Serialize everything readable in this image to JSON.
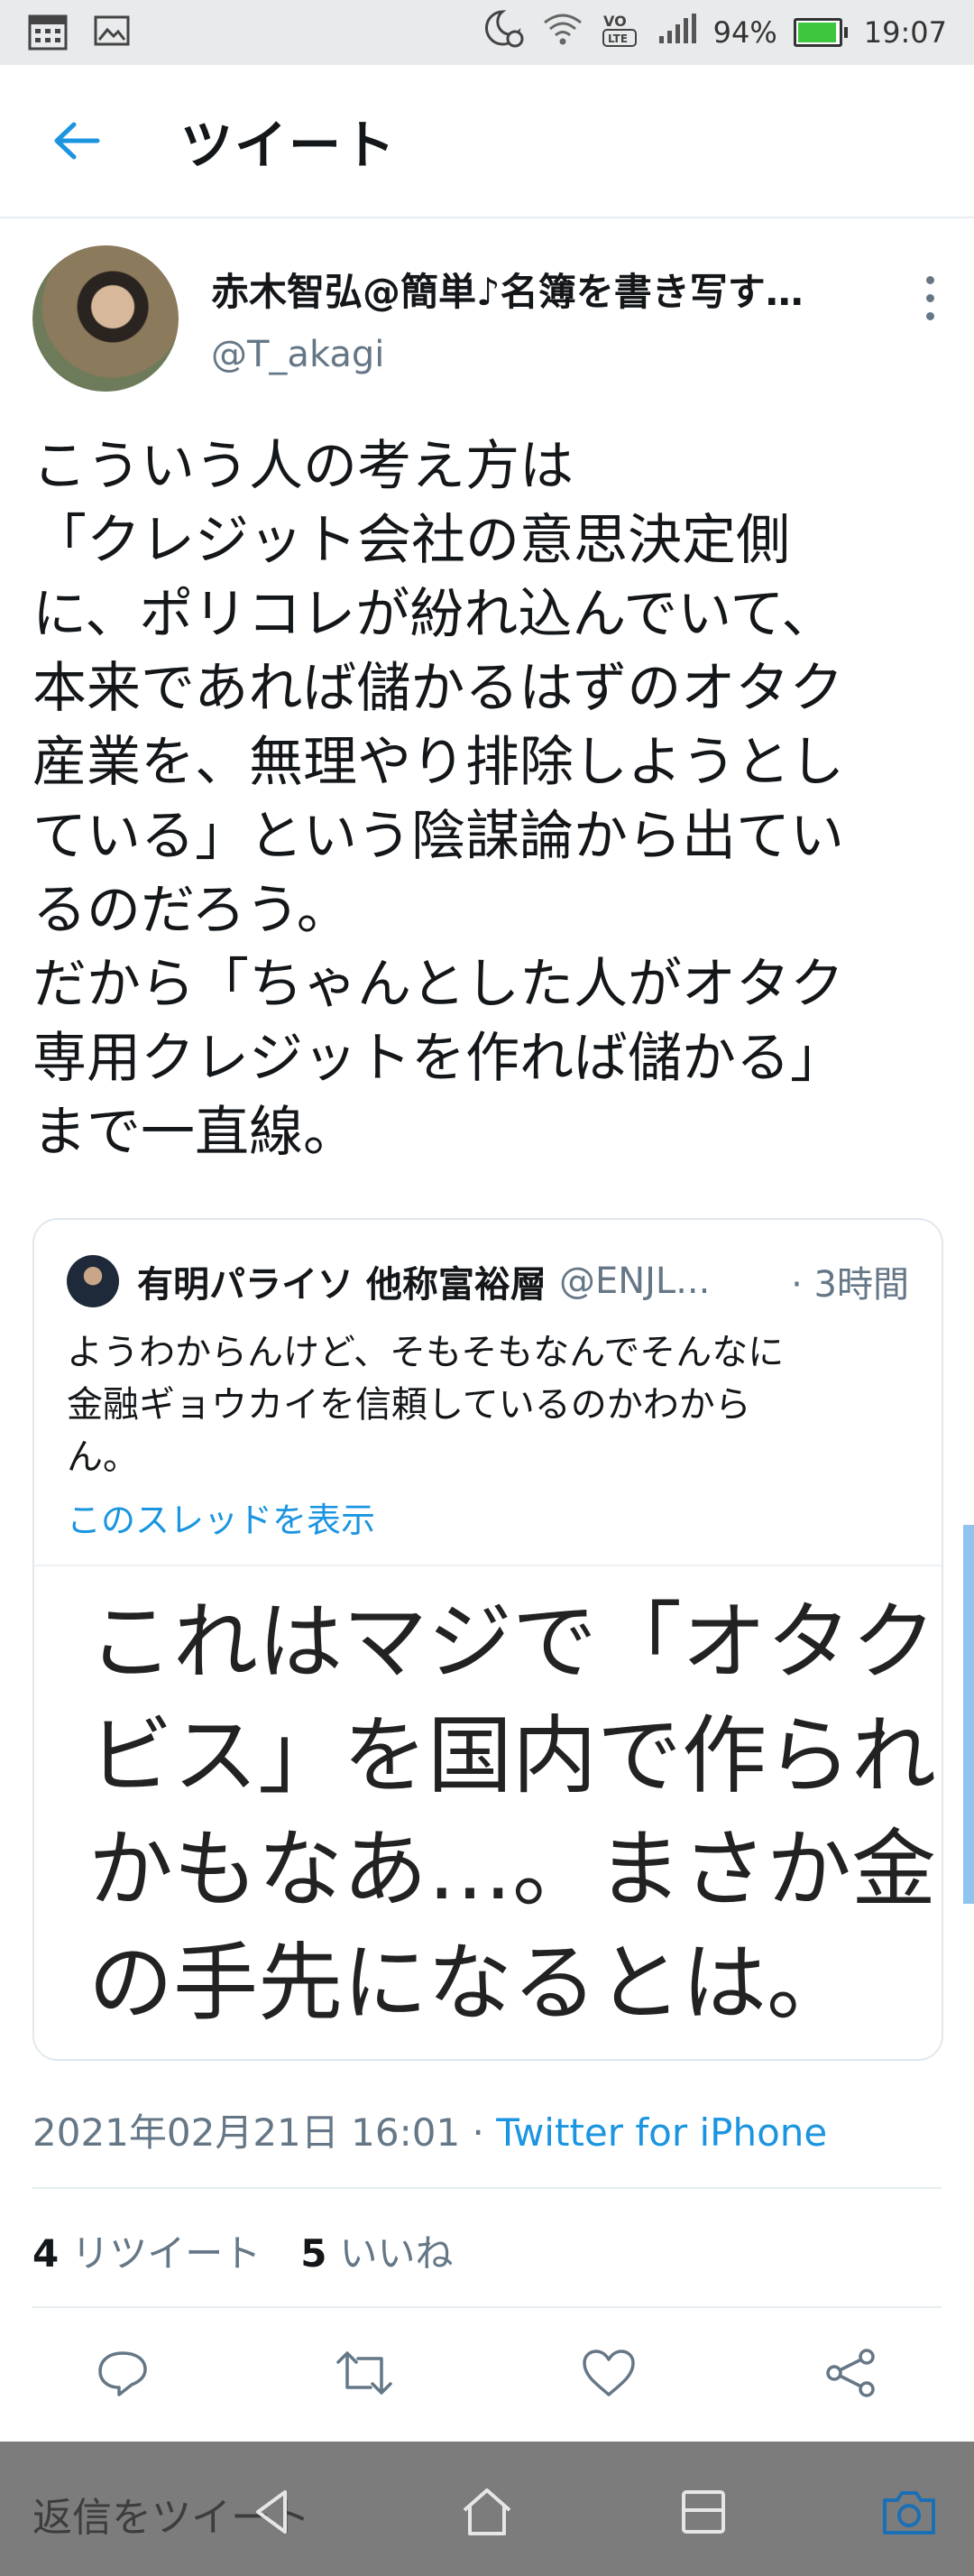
{
  "status_bar": {
    "battery": "94%",
    "battery_level": 0.94,
    "time": "19:07",
    "network": "VoLTE",
    "icons": [
      "calendar-icon",
      "image-icon",
      "moon-alarm-icon",
      "wifi-icon",
      "volte-icon",
      "signal-icon",
      "battery-icon"
    ]
  },
  "app_bar": {
    "title": "ツイート"
  },
  "tweet": {
    "author_name": "赤木智弘@簡単♪名簿を書き写す…",
    "author_handle": "@T_akagi",
    "text_lines": [
      "こういう人の考え方は",
      "「クレジット会社の意思決定側",
      "に、ポリコレが紛れ込んでいて、",
      "本来であれば儲かるはずのオタク",
      "産業を、無理やり排除しようとし",
      "ている」という陰謀論から出てい",
      "るのだろう。",
      "だから「ちゃんとした人がオタク",
      "専用クレジットを作れば儲かる」",
      "まで一直線。"
    ],
    "timestamp": "2021年02月21日 16:01",
    "separator": "·",
    "via": "Twitter for iPhone",
    "retweets_count": "4",
    "retweets_label": "リツイート",
    "likes_count": "5",
    "likes_label": "いいね"
  },
  "quoted_tweet": {
    "author_name": "有明パライソ 他称富裕層",
    "author_handle": "@ENJL...",
    "time": "· 3時間",
    "text_lines": [
      "ようわからんけど、そもそもなんでそんなに",
      "金融ギョウカイを信頼しているのかわから",
      "ん。"
    ],
    "thread_link": "このスレッドを表示",
    "image_text_lines": [
      "これはマジで「オタク",
      "ビス」を国内で作られ",
      "かもなあ…。まさか金",
      "の手先になるとは。"
    ]
  },
  "actions": [
    "reply-icon",
    "retweet-icon",
    "like-icon",
    "share-icon"
  ],
  "reply_bar": {
    "placeholder": "返信をツイート"
  },
  "colors": {
    "accent": "#1b95e0",
    "text_primary": "#14171a",
    "text_secondary": "#657786",
    "divider": "#e6ecf0",
    "status_bar_bg": "#e9eaeb",
    "nav_bar_bg": "#7c7c7c"
  }
}
